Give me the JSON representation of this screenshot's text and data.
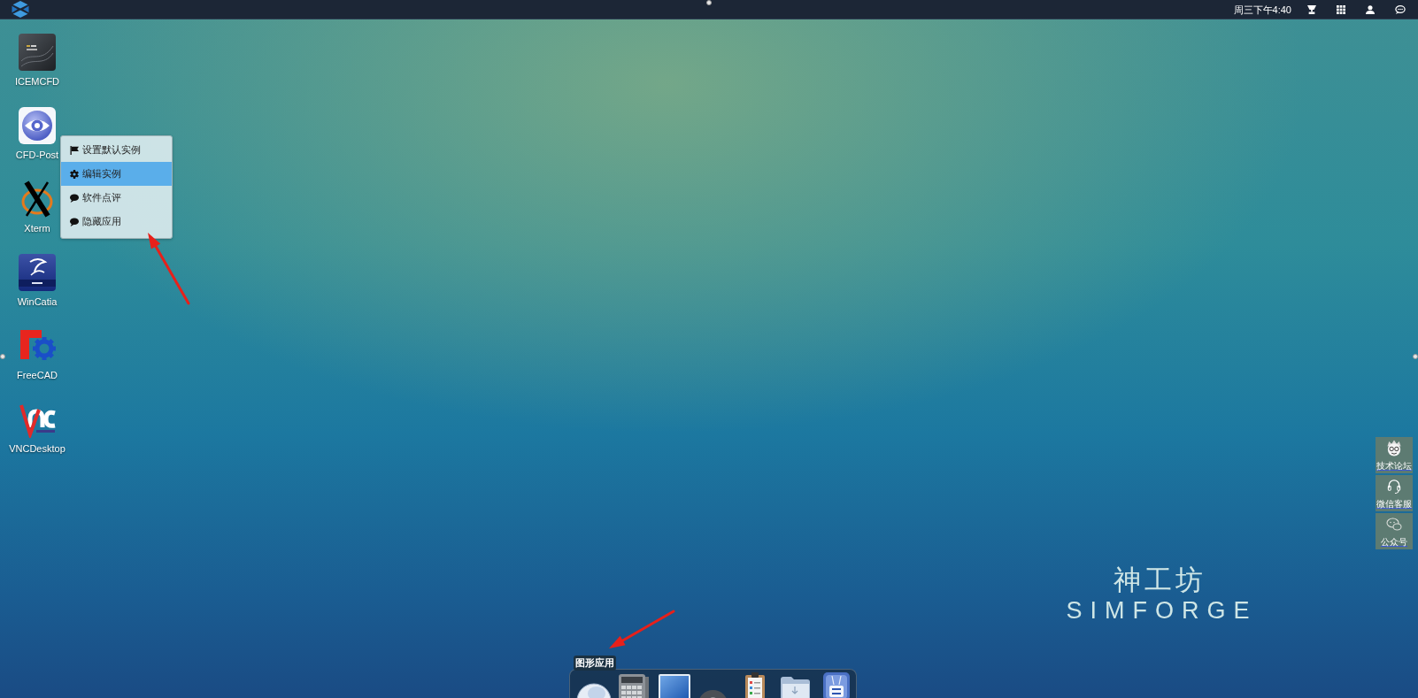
{
  "top_bar": {
    "clock": "周三下午4:40"
  },
  "desktop_icons": [
    {
      "label": "ICEMCFD",
      "kind": "panel"
    },
    {
      "label": "CFD-Post",
      "kind": "eye"
    },
    {
      "label": "Xterm",
      "kind": "cross"
    },
    {
      "label": "WinCatia",
      "kind": "swoosh"
    },
    {
      "label": "FreeCAD",
      "kind": "gear"
    },
    {
      "label": "VNCDesktop",
      "kind": "chevron"
    }
  ],
  "context_menu": {
    "items": [
      {
        "label": "设置默认实例",
        "kind": "flag",
        "selected": false
      },
      {
        "label": "编辑实例",
        "kind": "gear",
        "selected": true
      },
      {
        "label": "软件点评",
        "kind": "comment",
        "selected": false
      },
      {
        "label": "隐藏应用",
        "kind": "comment",
        "selected": false
      }
    ]
  },
  "side_links": [
    {
      "label": "技术论坛",
      "kind": "mascot"
    },
    {
      "label": "微信客服",
      "kind": "headset"
    },
    {
      "label": "公众号",
      "kind": "chat"
    }
  ],
  "brand": {
    "name": "神工坊",
    "wordmark": "SIMFORGE"
  },
  "dock": {
    "tooltip": "图形应用"
  }
}
